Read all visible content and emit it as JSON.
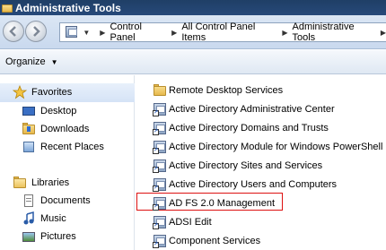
{
  "window": {
    "title": "Administrative Tools"
  },
  "address": {
    "crumbs": [
      "Control Panel",
      "All Control Panel Items",
      "Administrative Tools"
    ]
  },
  "toolbar": {
    "organize_label": "Organize"
  },
  "nav": {
    "favorites_label": "Favorites",
    "favorites": [
      "Desktop",
      "Downloads",
      "Recent Places"
    ],
    "libraries_label": "Libraries",
    "libraries": [
      "Documents",
      "Music",
      "Pictures"
    ]
  },
  "files": [
    "Remote Desktop Services",
    "Active Directory Administrative Center",
    "Active Directory Domains and Trusts",
    "Active Directory Module for Windows PowerShell",
    "Active Directory Sites and Services",
    "Active Directory Users and Computers",
    "AD FS 2.0 Management",
    "ADSI Edit",
    "Component Services"
  ],
  "highlighted_item": "AD FS 2.0 Management",
  "colors": {
    "titlebar": "#1f3f66",
    "highlight_border": "#dd1111"
  }
}
